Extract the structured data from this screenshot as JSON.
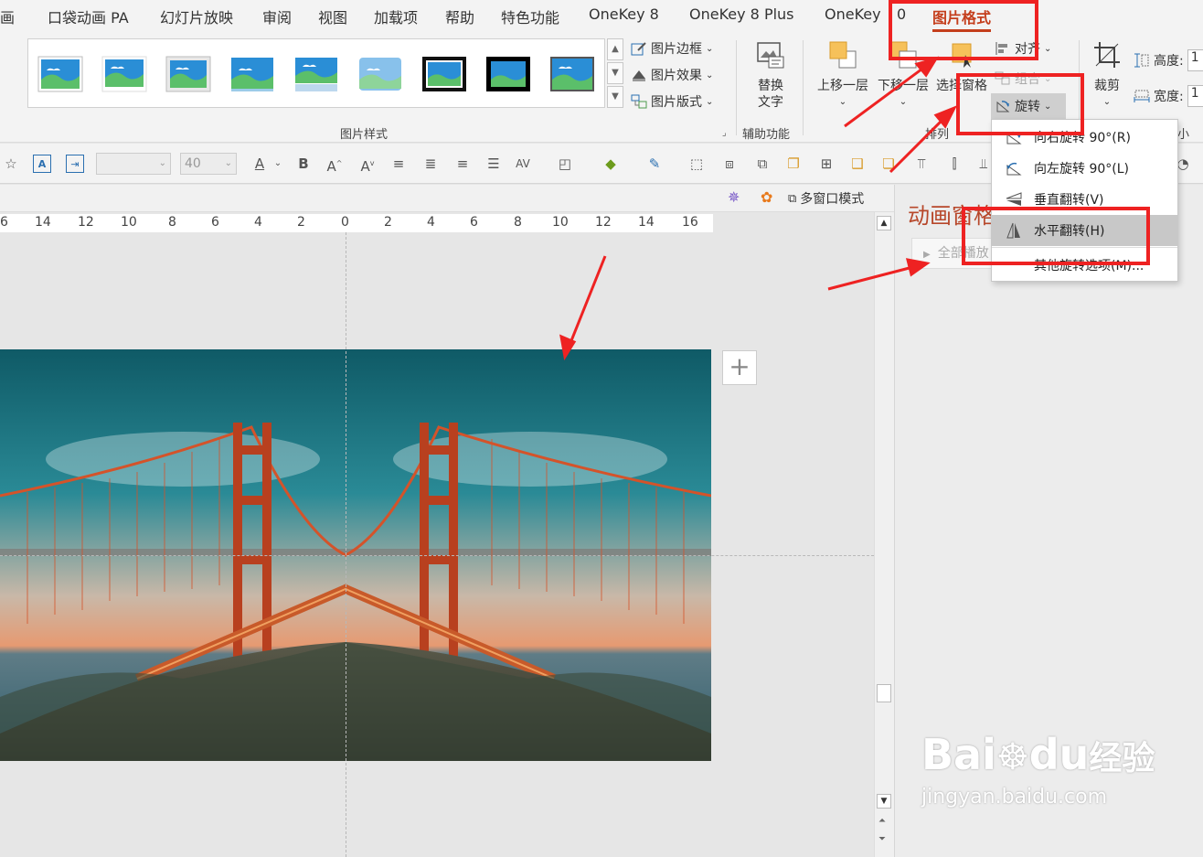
{
  "tabs": [
    {
      "label": "画"
    },
    {
      "label": "口袋动画 PA"
    },
    {
      "label": "幻灯片放映"
    },
    {
      "label": "审阅"
    },
    {
      "label": "视图"
    },
    {
      "label": "加载项"
    },
    {
      "label": "帮助"
    },
    {
      "label": "特色功能"
    },
    {
      "label": "OneKey 8"
    },
    {
      "label": "OneKey 8 Plus"
    },
    {
      "label": "OneKey"
    },
    {
      "label": "0"
    },
    {
      "label": "图片格式",
      "active": true
    }
  ],
  "ribbon": {
    "picture_styles": {
      "group_label": "图片样式",
      "border_label": "图片边框",
      "effects_label": "图片效果",
      "layout_label": "图片版式"
    },
    "accessibility": {
      "alt_text_line1": "替换",
      "alt_text_line2": "文字",
      "group_label": "辅助功能"
    },
    "arrange": {
      "bring_forward": "上移一层",
      "send_backward": "下移一层",
      "selection_pane": "选择窗格",
      "align": "对齐",
      "group": "组合",
      "rotate": "旋转",
      "group_label": "排列"
    },
    "size": {
      "crop": "裁剪",
      "height_label": "高度:",
      "width_label": "宽度:",
      "height_value": "1",
      "width_value": "1",
      "group_label_partial": "小"
    }
  },
  "format_toolbar": {
    "font_name": "",
    "font_size": "40"
  },
  "pane_bar": {
    "multi_window": "多窗口模式"
  },
  "ruler": {
    "labels": [
      "6",
      "14",
      "12",
      "10",
      "8",
      "6",
      "4",
      "2",
      "0",
      "2",
      "4",
      "6",
      "8",
      "10",
      "12",
      "14",
      "16"
    ]
  },
  "animation_pane": {
    "title": "动画窗格",
    "play_all": "全部播放"
  },
  "rotate_menu": {
    "items": [
      {
        "label": "向右旋转 90°(R)",
        "icon": "rotate-right-icon"
      },
      {
        "label": "向左旋转 90°(L)",
        "icon": "rotate-left-icon"
      },
      {
        "label": "垂直翻转(V)",
        "icon": "flip-vertical-icon"
      },
      {
        "label": "水平翻转(H)",
        "icon": "flip-horizontal-icon",
        "highlighted": true
      },
      {
        "label": "其他旋转选项(M)...",
        "icon": "none"
      }
    ]
  },
  "watermark": {
    "brand": "Bai",
    "brand2": "du",
    "brand_cn": "经验",
    "url": "jingyan.baidu.com"
  },
  "colors": {
    "accent": "#c43e1c",
    "annotation_red": "#ee2222",
    "menu_highlight": "#c8c8c8"
  }
}
